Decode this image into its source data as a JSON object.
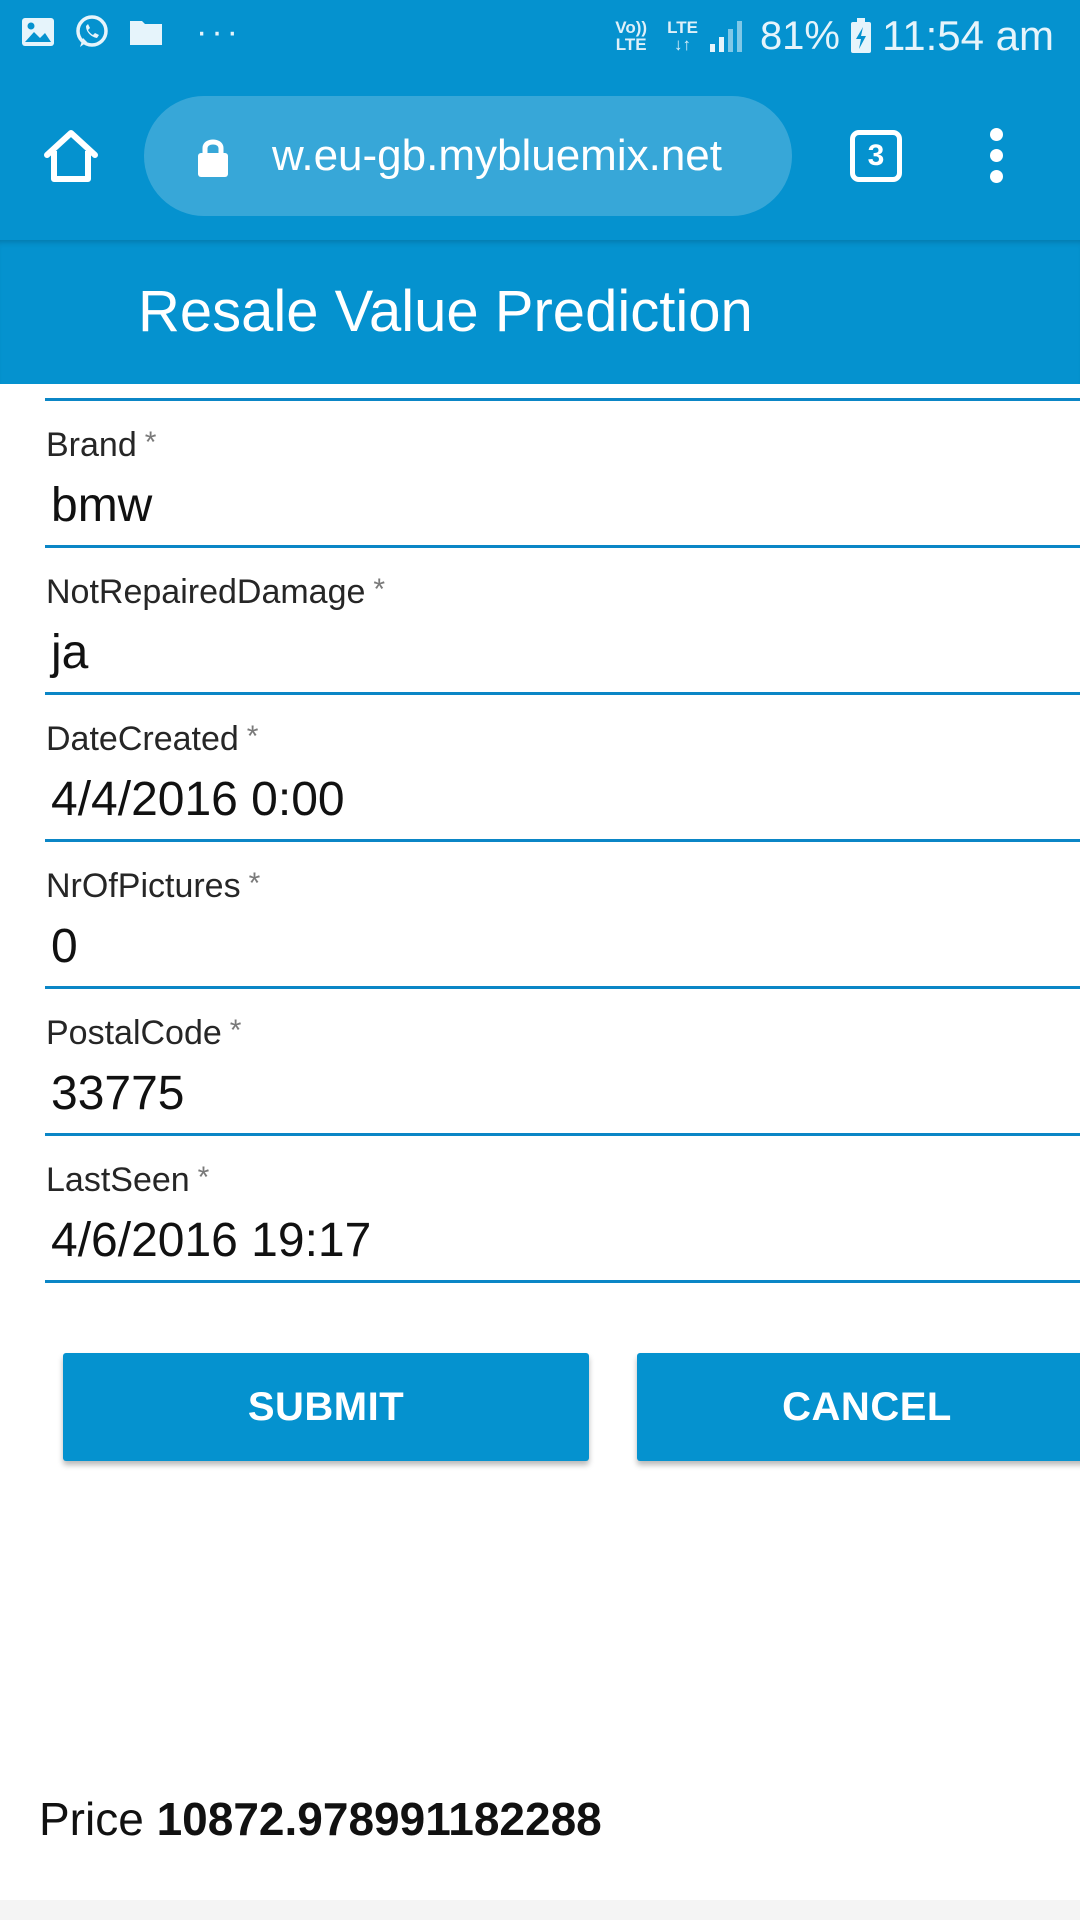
{
  "status_bar": {
    "volte": "Vo)) LTE",
    "lte": "LTE",
    "battery_percent": "81%",
    "time": "11:54 am"
  },
  "browser": {
    "url": "w.eu-gb.mybluemix.net",
    "tab_count": "3"
  },
  "app": {
    "title": "Resale Value Prediction"
  },
  "form": {
    "fields": [
      {
        "label": "Brand",
        "required": "*",
        "value": "bmw"
      },
      {
        "label": "NotRepairedDamage",
        "required": "*",
        "value": "ja"
      },
      {
        "label": "DateCreated",
        "required": "*",
        "value": "4/4/2016 0:00"
      },
      {
        "label": "NrOfPictures",
        "required": "*",
        "value": "0"
      },
      {
        "label": "PostalCode",
        "required": "*",
        "value": "33775"
      },
      {
        "label": "LastSeen",
        "required": "*",
        "value": "4/6/2016 19:17"
      }
    ],
    "submit_label": "SUBMIT",
    "cancel_label": "CANCEL"
  },
  "result": {
    "label": "Price",
    "value": "10872.978991182288"
  },
  "colors": {
    "primary": "#0592cf",
    "underline": "#0b86c6"
  }
}
